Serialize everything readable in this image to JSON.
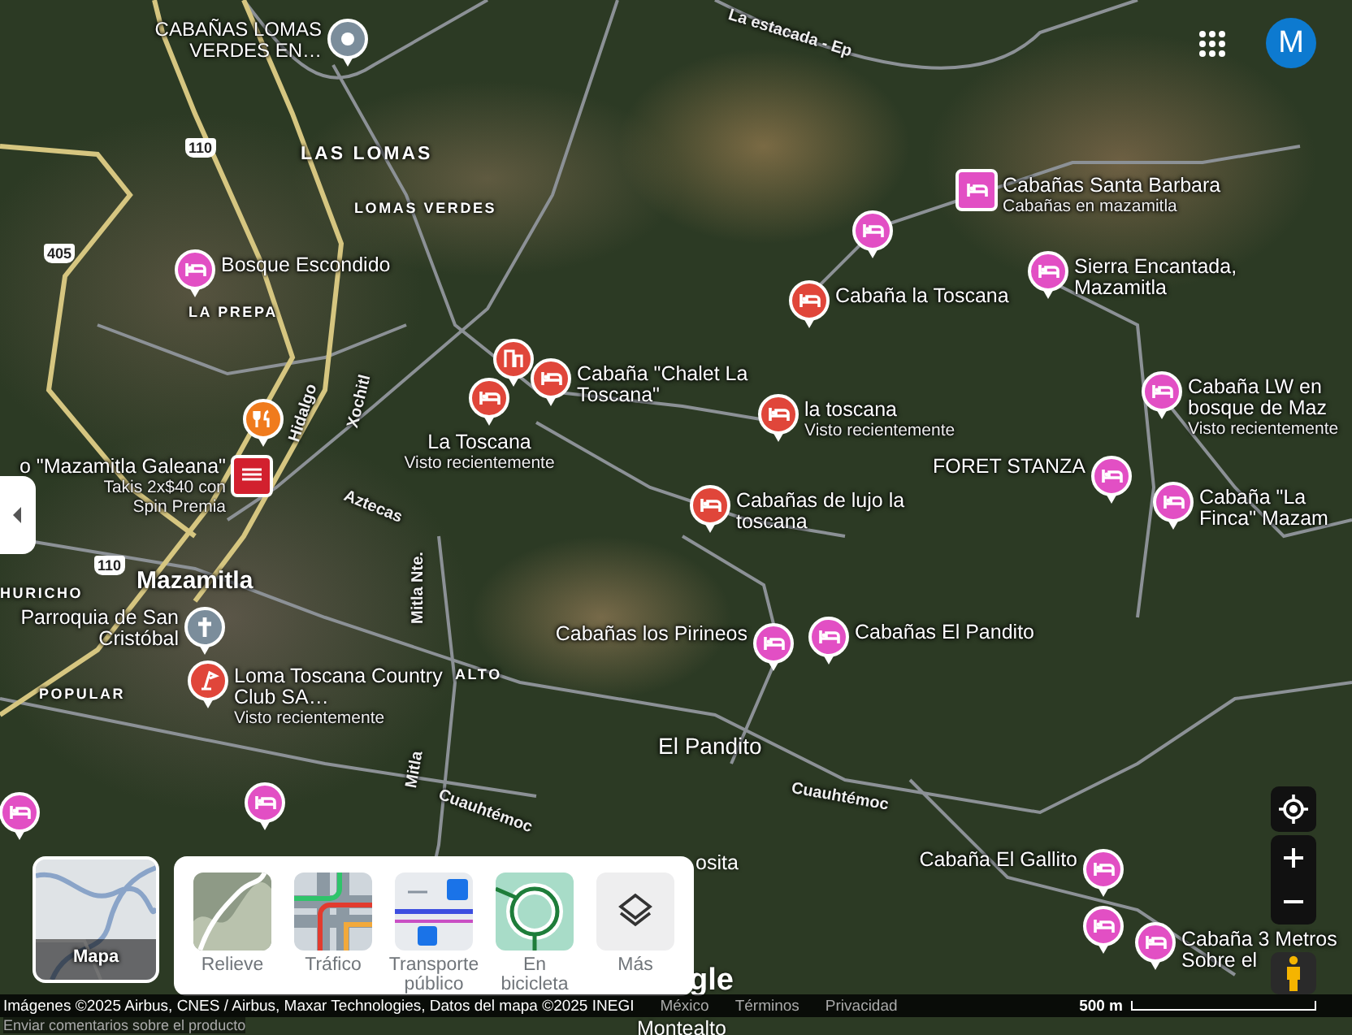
{
  "map": {
    "area_labels": [
      {
        "text": "La estacada - Ep",
        "kind": "road"
      },
      {
        "text": "LAS LOMAS",
        "kind": "district"
      },
      {
        "text": "LOMAS VERDES",
        "kind": "neighborhood"
      },
      {
        "text": "LA PREPA",
        "kind": "neighborhood"
      },
      {
        "text": "Hidalgo",
        "kind": "road"
      },
      {
        "text": "Xochitl",
        "kind": "road"
      },
      {
        "text": "Aztecas",
        "kind": "road"
      },
      {
        "text": "Mazamitla",
        "kind": "town"
      },
      {
        "text": "HURICHO",
        "kind": "neighborhood"
      },
      {
        "text": "Mitla Nte.",
        "kind": "road"
      },
      {
        "text": "ALTO",
        "kind": "neighborhood"
      },
      {
        "text": "POPULAR",
        "kind": "neighborhood"
      },
      {
        "text": "El Pandito",
        "kind": "village"
      },
      {
        "text": "Mitla",
        "kind": "road"
      },
      {
        "text": "Cuauhtémoc",
        "kind": "road"
      },
      {
        "text": "Cuauhtémoc",
        "kind": "road"
      }
    ],
    "road_shields": [
      {
        "text": "110"
      },
      {
        "text": "405"
      },
      {
        "text": "110"
      }
    ],
    "places": [
      {
        "name": "CABAÑAS LOMAS VERDES EN…",
        "kind": "generic",
        "color": "#7b8d9b"
      },
      {
        "name": "Cabañas Santa Barbara",
        "subtitle": "Cabañas en mazamitla",
        "kind": "lodging_square",
        "color": "#e24fc4"
      },
      {
        "name": "Bosque Escondido",
        "kind": "lodging",
        "color": "#e24fc4"
      },
      {
        "kind": "lodging",
        "color": "#e24fc4"
      },
      {
        "name": "Sierra Encantada, Mazamitla",
        "kind": "lodging",
        "color": "#e24fc4"
      },
      {
        "name": "Cabaña la Toscana",
        "kind": "lodging",
        "color": "#e0463a"
      },
      {
        "kind": "building",
        "color": "#e0463a"
      },
      {
        "name": "Cabaña \"Chalet La Toscana\"",
        "kind": "lodging",
        "color": "#e0463a"
      },
      {
        "name": "La Toscana",
        "subtitle": "Visto recientemente",
        "kind": "lodging",
        "color": "#e0463a"
      },
      {
        "name": "la toscana",
        "subtitle": "Visto recientemente",
        "kind": "lodging",
        "color": "#e0463a"
      },
      {
        "name": "Cabaña LW en bosque de Maz",
        "subtitle": "Visto recientemente",
        "kind": "lodging",
        "color": "#e24fc4"
      },
      {
        "kind": "restaurant",
        "color": "#f07b1d"
      },
      {
        "name": "o \"Mazamitla Galeana\"",
        "subtitle": "Takis 2x$40 con Spin Premia",
        "kind": "store",
        "color": "#d2202e"
      },
      {
        "name": "FORET STANZA",
        "kind": "lodging",
        "color": "#e24fc4"
      },
      {
        "name": "Cabañas de lujo la toscana",
        "kind": "lodging",
        "color": "#e0463a"
      },
      {
        "name": "Cabaña \"La Finca\" Mazam",
        "kind": "lodging",
        "color": "#e24fc4"
      },
      {
        "name": "Parroquia de San Cristóbal",
        "kind": "church",
        "color": "#7b8d9b"
      },
      {
        "name": "Loma Toscana Country Club SA…",
        "subtitle": "Visto recientemente",
        "kind": "golf",
        "color": "#e0463a"
      },
      {
        "name": "Cabañas los Pirineos",
        "kind": "lodging",
        "color": "#e24fc4"
      },
      {
        "name": "Cabañas El Pandito",
        "kind": "lodging",
        "color": "#e24fc4"
      },
      {
        "kind": "lodging",
        "color": "#e24fc4"
      },
      {
        "kind": "lodging",
        "color": "#e24fc4"
      },
      {
        "name": "Cabaña El Gallito",
        "kind": "lodging",
        "color": "#e24fc4"
      },
      {
        "kind": "lodging",
        "color": "#e24fc4"
      },
      {
        "name": "Cabaña 3 Metros Sobre el",
        "kind": "lodging",
        "color": "#e24fc4"
      }
    ],
    "partial_labels": [
      {
        "text": "osita",
        "kind": "place"
      },
      {
        "text": "gle",
        "kind": "logo"
      },
      {
        "text": "Montealto",
        "kind": "place"
      }
    ]
  },
  "account": {
    "avatar_letter": "M"
  },
  "base_map": {
    "label": "Mapa"
  },
  "layers": [
    {
      "label": "Relieve",
      "kind": "terrain"
    },
    {
      "label": "Tráfico",
      "kind": "traffic"
    },
    {
      "label": "Transporte público",
      "kind": "transit"
    },
    {
      "label": "En bicicleta",
      "kind": "biking"
    },
    {
      "label": "Más",
      "kind": "more"
    }
  ],
  "footer": {
    "attribution": "Imágenes ©2025 Airbus, CNES / Airbus, Maxar Technologies, Datos del mapa ©2025 INEGI",
    "links": [
      "México",
      "Términos",
      "Privacidad"
    ],
    "scale": "500 m",
    "feedback": "Enviar comentarios sobre el producto"
  }
}
